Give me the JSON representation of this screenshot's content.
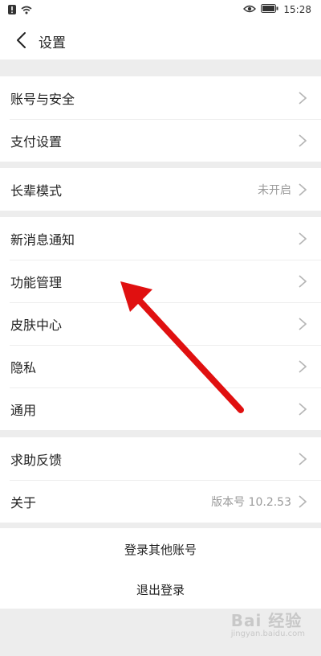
{
  "status": {
    "time": "15:28",
    "icons": [
      "alert-icon",
      "wifi-icon",
      "eye-icon",
      "battery-icon"
    ]
  },
  "header": {
    "title": "设置"
  },
  "groups": [
    {
      "items": [
        {
          "label": "账号与安全"
        },
        {
          "label": "支付设置"
        }
      ]
    },
    {
      "items": [
        {
          "label": "长辈模式",
          "value": "未开启"
        }
      ]
    },
    {
      "items": [
        {
          "label": "新消息通知"
        },
        {
          "label": "功能管理"
        },
        {
          "label": "皮肤中心"
        },
        {
          "label": "隐私"
        },
        {
          "label": "通用"
        }
      ]
    },
    {
      "items": [
        {
          "label": "求助反馈"
        },
        {
          "label": "关于",
          "value": "版本号 10.2.53"
        }
      ]
    }
  ],
  "actions": {
    "switch_account": "登录其他账号",
    "logout": "退出登录"
  },
  "watermark": {
    "logo": "Bai 经验",
    "sub": "jingyan.baidu.com"
  },
  "colors": {
    "annotation_arrow": "#e01010",
    "background": "#ededed"
  }
}
